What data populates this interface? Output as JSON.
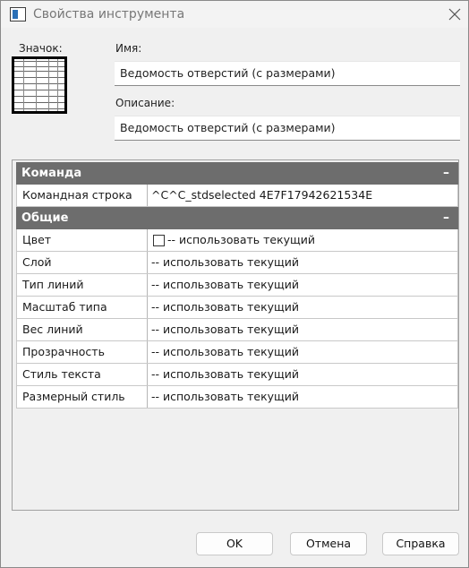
{
  "window": {
    "title": "Свойства инструмента"
  },
  "icon_section": {
    "label": "Значок:"
  },
  "name_field": {
    "label": "Имя:",
    "value": "Ведомость отверстий (с размерами)"
  },
  "description_field": {
    "label": "Описание:",
    "value": "Ведомость отверстий (с размерами)"
  },
  "property_grid": {
    "sections": [
      {
        "title": "Команда",
        "toggle": "–",
        "rows": [
          {
            "name": "Командная строка",
            "value": "^C^C_stdselected 4E7F17942621534E"
          }
        ]
      },
      {
        "title": "Общие",
        "toggle": "–",
        "rows": [
          {
            "name": "Цвет",
            "value": "-- использовать текущий"
          },
          {
            "name": "Слой",
            "value": "-- использовать текущий"
          },
          {
            "name": "Тип линий",
            "value": "-- использовать текущий"
          },
          {
            "name": "Масштаб типа линий",
            "value": "-- использовать текущий"
          },
          {
            "name": "Вес линий",
            "value": "-- использовать текущий"
          },
          {
            "name": "Прозрачность",
            "value": "-- использовать текущий"
          },
          {
            "name": "Стиль текста",
            "value": "-- использовать текущий"
          },
          {
            "name": "Размерный стиль",
            "value": "-- использовать текущий"
          }
        ]
      }
    ]
  },
  "buttons": {
    "ok": "OK",
    "cancel": "Отмена",
    "help": "Справка"
  },
  "colors": {
    "section_header": "#6d6d6d",
    "window_bg": "#f0f0f0"
  }
}
